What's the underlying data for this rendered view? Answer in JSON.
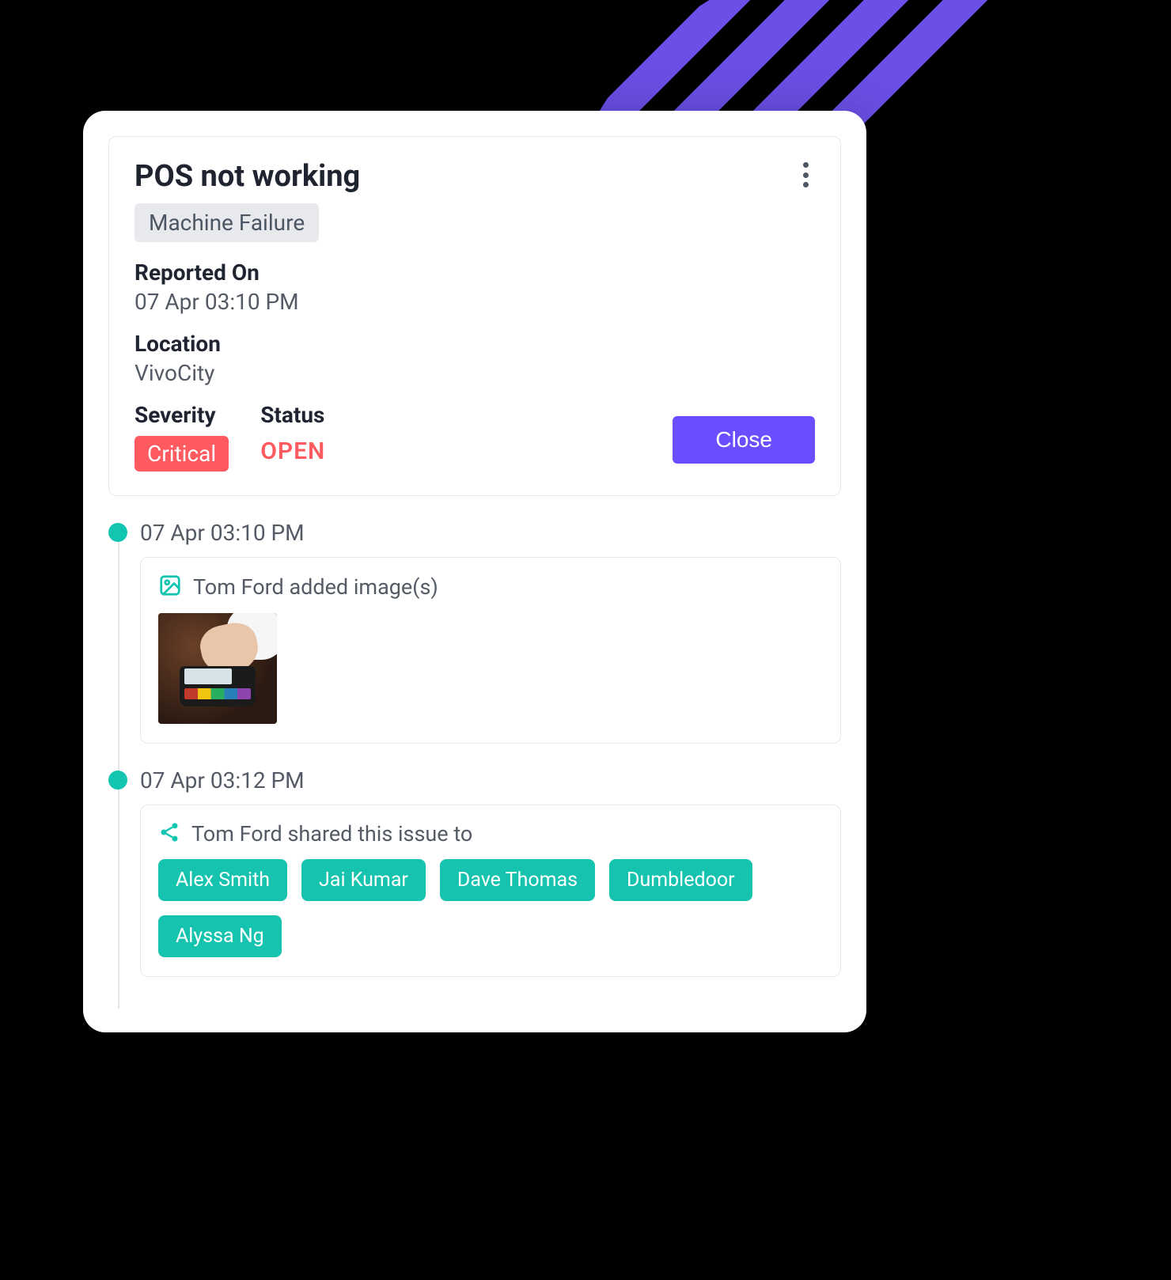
{
  "issue": {
    "title": "POS not working",
    "category": "Machine Failure",
    "reported_on_label": "Reported On",
    "reported_on_value": "07 Apr 03:10 PM",
    "location_label": "Location",
    "location_value": "VivoCity",
    "severity_label": "Severity",
    "severity_value": "Critical",
    "status_label": "Status",
    "status_value": "OPEN",
    "close_button": "Close"
  },
  "colors": {
    "accent_purple": "#6c4dff",
    "stripe_purple": "#6b4fe6",
    "teal": "#11c5b0",
    "chip_teal": "#16c3ae",
    "danger": "#ff5a5f"
  },
  "timeline": [
    {
      "time": "07 Apr 03:10 PM",
      "icon": "image-icon",
      "text": "Tom Ford added image(s)",
      "type": "image"
    },
    {
      "time": "07 Apr 03:12 PM",
      "icon": "share-icon",
      "text": "Tom Ford shared this issue to",
      "type": "share",
      "people": [
        "Alex Smith",
        "Jai Kumar",
        "Dave Thomas",
        "Dumbledoor",
        "Alyssa Ng"
      ]
    }
  ]
}
